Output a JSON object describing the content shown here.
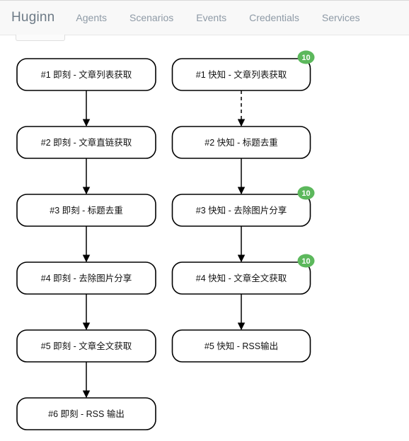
{
  "navbar": {
    "brand": "Huginn",
    "items": [
      {
        "label": "Agents"
      },
      {
        "label": "Scenarios"
      },
      {
        "label": "Events"
      },
      {
        "label": "Credentials"
      },
      {
        "label": "Services"
      }
    ]
  },
  "colors": {
    "badge_green": "#5cb85c",
    "node_stroke": "#000000",
    "node_fill": "#ffffff",
    "navbar_bg": "#f8f8f8",
    "brand_text": "#6d7a86",
    "nav_text": "#8e9aa6"
  },
  "diagram": {
    "columns": [
      {
        "name": "jike-column",
        "nodes": [
          {
            "label": "#1 即刻 - 文章列表获取",
            "badge": null
          },
          {
            "label": "#2 即刻 - 文章直链获取",
            "badge": null
          },
          {
            "label": "#3 即刻 - 标题去重",
            "badge": null
          },
          {
            "label": "#4 即刻 - 去除图片分享",
            "badge": null
          },
          {
            "label": "#5 即刻 - 文章全文获取",
            "badge": null
          },
          {
            "label": "#6 即刻 - RSS 输出",
            "badge": null
          }
        ],
        "edges": [
          {
            "from": 0,
            "to": 1,
            "style": "solid"
          },
          {
            "from": 1,
            "to": 2,
            "style": "solid"
          },
          {
            "from": 2,
            "to": 3,
            "style": "solid"
          },
          {
            "from": 3,
            "to": 4,
            "style": "solid"
          },
          {
            "from": 4,
            "to": 5,
            "style": "solid"
          }
        ]
      },
      {
        "name": "kuaizhi-column",
        "nodes": [
          {
            "label": "#1 快知 - 文章列表获取",
            "badge": "10"
          },
          {
            "label": "#2 快知 - 标题去重",
            "badge": null
          },
          {
            "label": "#3 快知 - 去除图片分享",
            "badge": "10"
          },
          {
            "label": "#4 快知 - 文章全文获取",
            "badge": "10"
          },
          {
            "label": "#5 快知 - RSS输出",
            "badge": null
          }
        ],
        "edges": [
          {
            "from": 0,
            "to": 1,
            "style": "dashed"
          },
          {
            "from": 1,
            "to": 2,
            "style": "solid"
          },
          {
            "from": 2,
            "to": 3,
            "style": "solid"
          },
          {
            "from": 3,
            "to": 4,
            "style": "solid"
          }
        ]
      }
    ]
  }
}
